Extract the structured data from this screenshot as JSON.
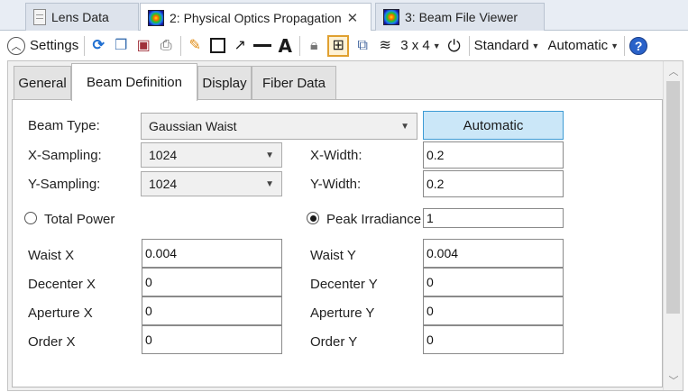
{
  "doc_tabs": [
    {
      "label": "Lens Data",
      "icon": "document-icon",
      "active": false
    },
    {
      "label": "2: Physical Optics Propagation",
      "icon": "beam-icon",
      "active": true
    },
    {
      "label": "3: Beam File Viewer",
      "icon": "beam-icon",
      "active": false
    }
  ],
  "toolbar": {
    "settings_label": "Settings",
    "grid_label": "3 x 4",
    "standard_label": "Standard",
    "automatic_label": "Automatic",
    "help_label": "?"
  },
  "sub_tabs": [
    {
      "label": "General",
      "active": false
    },
    {
      "label": "Beam Definition",
      "active": true
    },
    {
      "label": "Display",
      "active": false
    },
    {
      "label": "Fiber Data",
      "active": false
    }
  ],
  "form": {
    "beam_type_label": "Beam Type:",
    "beam_type_value": "Gaussian Waist",
    "automatic_button": "Automatic",
    "x_sampling_label": "X-Sampling:",
    "x_sampling_value": "1024",
    "y_sampling_label": "Y-Sampling:",
    "y_sampling_value": "1024",
    "x_width_label": "X-Width:",
    "x_width_value": "0.2",
    "y_width_label": "Y-Width:",
    "y_width_value": "0.2",
    "total_power_label": "Total Power",
    "total_power_selected": false,
    "peak_irradiance_label": "Peak Irradiance",
    "peak_irradiance_selected": true,
    "peak_irradiance_value": "1",
    "waist_x_label": "Waist X",
    "waist_x_value": "0.004",
    "waist_y_label": "Waist Y",
    "waist_y_value": "0.004",
    "decenter_x_label": "Decenter X",
    "decenter_x_value": "0",
    "decenter_y_label": "Decenter Y",
    "decenter_y_value": "0",
    "aperture_x_label": "Aperture X",
    "aperture_x_value": "0",
    "aperture_y_label": "Aperture Y",
    "aperture_y_value": "0",
    "order_x_label": "Order X",
    "order_x_value": "0",
    "order_y_label": "Order Y",
    "order_y_value": "0"
  },
  "colors": {
    "tab_strip": "#e8edf4",
    "automatic_button_fill": "#cbe7f8",
    "automatic_button_border": "#3d9bd4",
    "help_blue": "#2a62c9"
  }
}
